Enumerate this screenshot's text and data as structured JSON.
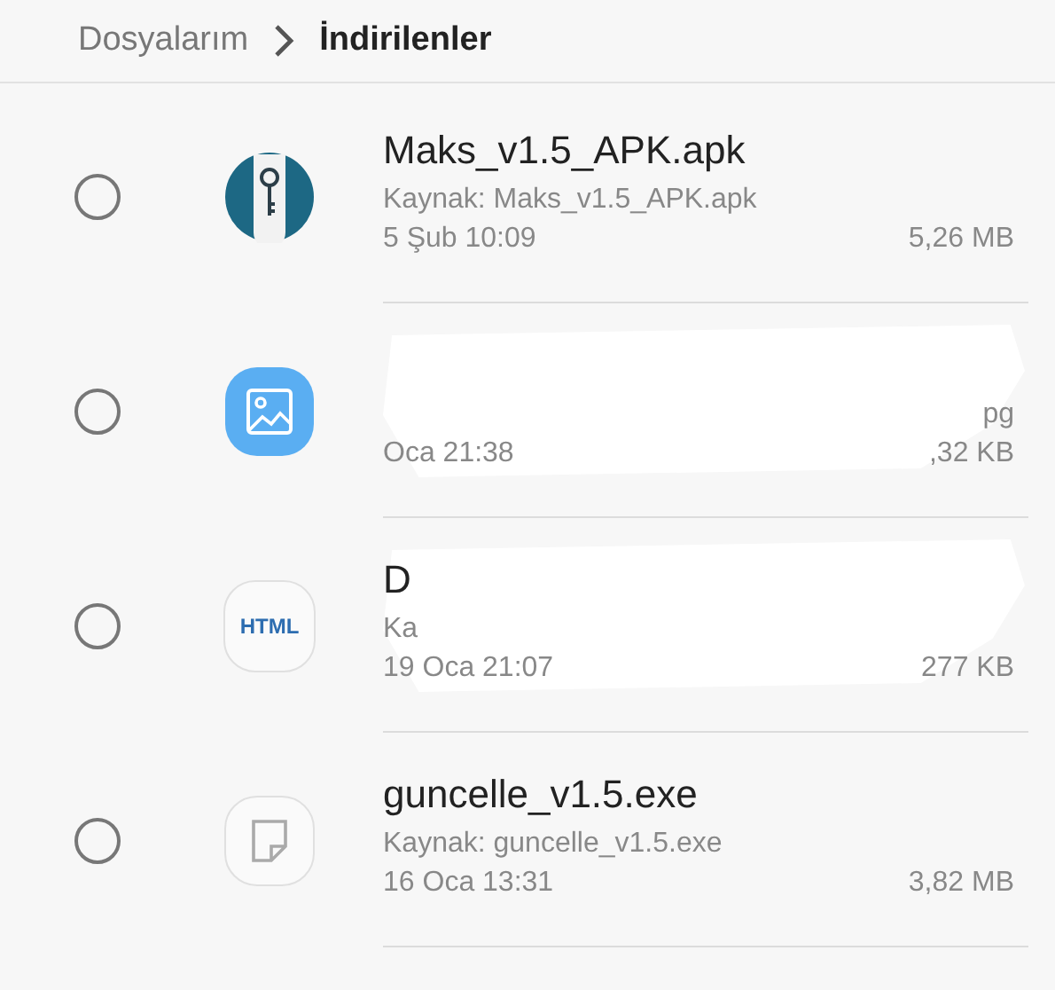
{
  "breadcrumb": [
    {
      "label": "Dosyalarım",
      "current": false
    },
    {
      "label": "İndirilenler",
      "current": true
    }
  ],
  "files": [
    {
      "kind": "apk",
      "selected": false,
      "redacted": false,
      "name": "Maks_v1.5_APK.apk",
      "source": "Kaynak: Maks_v1.5_APK.apk",
      "date": "5 Şub 10:09",
      "size": "5,26 MB"
    },
    {
      "kind": "image",
      "selected": false,
      "redacted": true,
      "source": "pg",
      "date": "Oca 21:38",
      "size": ",32 KB"
    },
    {
      "kind": "html",
      "icon_text": "HTML",
      "selected": false,
      "redacted": true,
      "name": "D",
      "source": "Ka",
      "date": "19 Oca 21:07",
      "size": "277 KB"
    },
    {
      "kind": "file",
      "selected": false,
      "redacted": false,
      "name": "guncelle_v1.5.exe",
      "source": "Kaynak: guncelle_v1.5.exe",
      "date": "16 Oca 13:31",
      "size": "3,82 MB"
    }
  ]
}
